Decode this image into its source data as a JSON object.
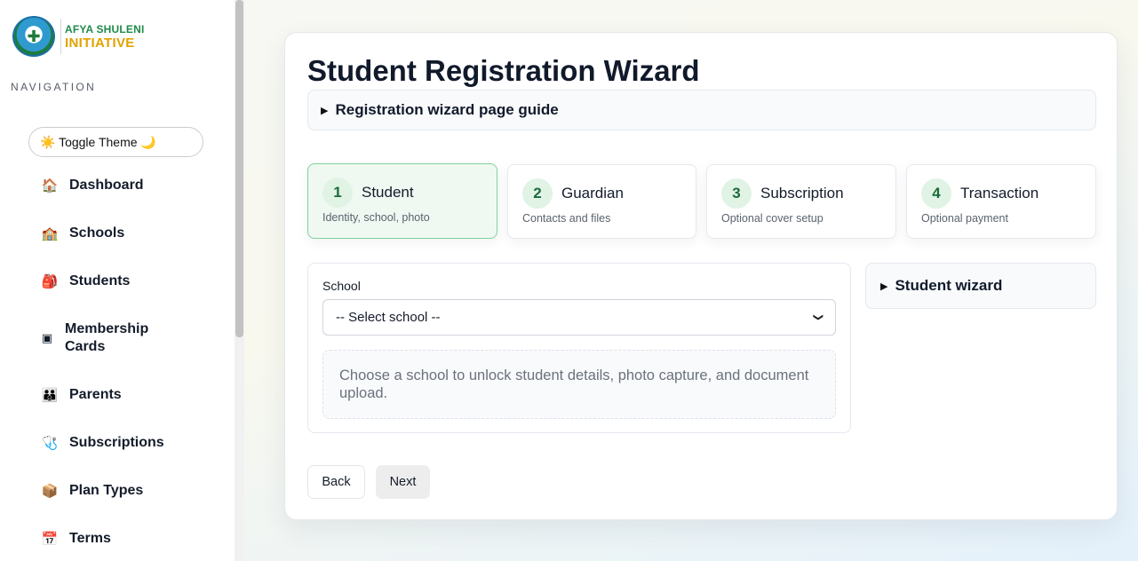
{
  "sidebar": {
    "logo": {
      "line1": "AFYA SHULENI",
      "line2": "INITIATIVE",
      "icon": "school-crest-logo"
    },
    "nav_heading": "NAVIGATION",
    "toggle_theme": "☀️ Toggle Theme 🌙",
    "items": [
      {
        "label": "Dashboard",
        "icon": "🏠"
      },
      {
        "label": "Schools",
        "icon": "🏫"
      },
      {
        "label": "Students",
        "icon": "🎒"
      },
      {
        "label": "Membership Cards",
        "icon": "▣"
      },
      {
        "label": "Parents",
        "icon": "👪"
      },
      {
        "label": "Subscriptions",
        "icon": "🩺"
      },
      {
        "label": "Plan Types",
        "icon": "📦"
      },
      {
        "label": "Terms",
        "icon": "📅"
      }
    ]
  },
  "main": {
    "title": "Student Registration Wizard",
    "guide_label": "Registration wizard page guide",
    "steps": [
      {
        "num": "1",
        "title": "Student",
        "sub": "Identity, school, photo"
      },
      {
        "num": "2",
        "title": "Guardian",
        "sub": "Contacts and files"
      },
      {
        "num": "3",
        "title": "Subscription",
        "sub": "Optional cover setup"
      },
      {
        "num": "4",
        "title": "Transaction",
        "sub": "Optional payment"
      }
    ],
    "school_label": "School",
    "school_select_value": "-- Select school --",
    "hint": "Choose a school to unlock student details, photo capture, and document upload.",
    "side_panel_label": "Student wizard",
    "back_label": "Back",
    "next_label": "Next"
  },
  "colors": {
    "accent_green": "#1c6b39",
    "active_step_bg": "#eff9f1",
    "active_step_border": "#7ed39b",
    "logo_green": "#1f8a4a",
    "logo_gold": "#e2a200"
  }
}
